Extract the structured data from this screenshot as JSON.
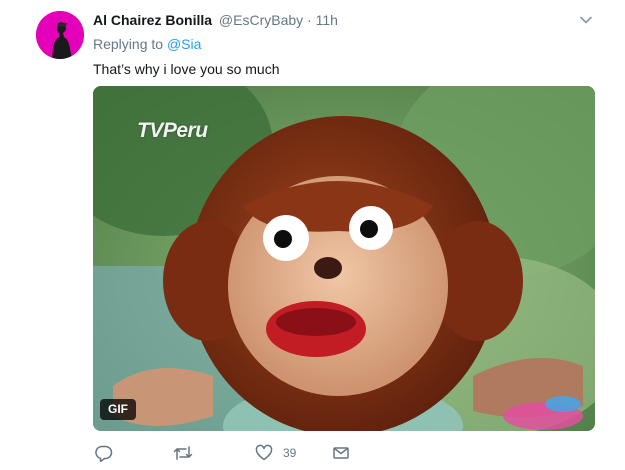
{
  "tweet": {
    "author_name": "Al Chairez Bonilla",
    "author_handle": "@EsCryBaby",
    "separator": "·",
    "time": "11h",
    "replying_prefix": "Replying to",
    "replying_to": "@Sia",
    "text": "That’s why i love you so much"
  },
  "media": {
    "watermark": "TVPeru",
    "badge": "GIF"
  },
  "actions": {
    "reply_icon": "reply-icon",
    "retweet_icon": "retweet-icon",
    "like_icon": "heart-icon",
    "like_count": "39",
    "dm_icon": "envelope-icon"
  },
  "colors": {
    "link": "#1da1f2",
    "secondary_text": "#657786",
    "avatar_bg": "#e400b8"
  }
}
